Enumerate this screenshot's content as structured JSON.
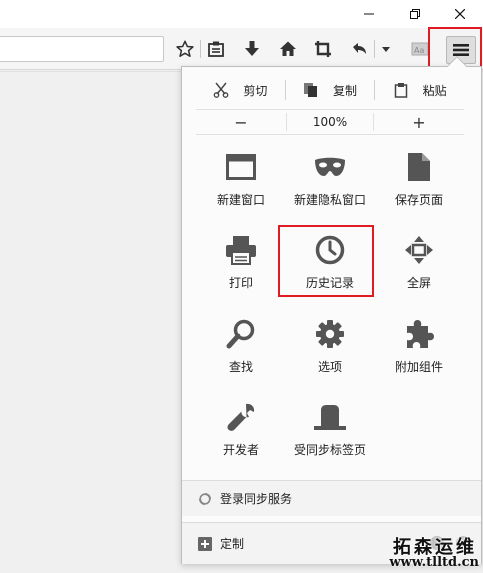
{
  "window_controls": {
    "minimize_icon": "minimize-icon",
    "maximize_icon": "restore-icon",
    "close_icon": "close-icon"
  },
  "toolbar": {
    "icons": [
      "star-icon",
      "reading-list-icon",
      "download-icon",
      "home-icon",
      "screenshot-icon",
      "undo-icon",
      "chevron-down-icon",
      "reader-view-icon",
      "hamburger-menu-icon"
    ]
  },
  "menu": {
    "edit": {
      "cut": "剪切",
      "copy": "复制",
      "paste": "粘贴"
    },
    "zoom": {
      "out": "−",
      "level": "100%",
      "in": "+"
    },
    "items": [
      {
        "label": "新建窗口",
        "icon": "new-window-icon"
      },
      {
        "label": "新建隐私窗口",
        "icon": "private-mask-icon"
      },
      {
        "label": "保存页面",
        "icon": "save-page-icon"
      },
      {
        "label": "打印",
        "icon": "printer-icon"
      },
      {
        "label": "历史记录",
        "icon": "clock-icon"
      },
      {
        "label": "全屏",
        "icon": "fullscreen-icon"
      },
      {
        "label": "查找",
        "icon": "magnifier-icon"
      },
      {
        "label": "选项",
        "icon": "gear-icon"
      },
      {
        "label": "附加组件",
        "icon": "puzzle-icon"
      },
      {
        "label": "开发者",
        "icon": "wrench-icon"
      },
      {
        "label": "受同步标签页",
        "icon": "synced-tabs-icon"
      }
    ],
    "sync": "登录同步服务",
    "customize": "定制"
  },
  "watermark": {
    "text": "拓森运维",
    "url": "www.tlltd.cn"
  },
  "colors": {
    "highlight": "#e01b24",
    "icon": "#555555"
  }
}
